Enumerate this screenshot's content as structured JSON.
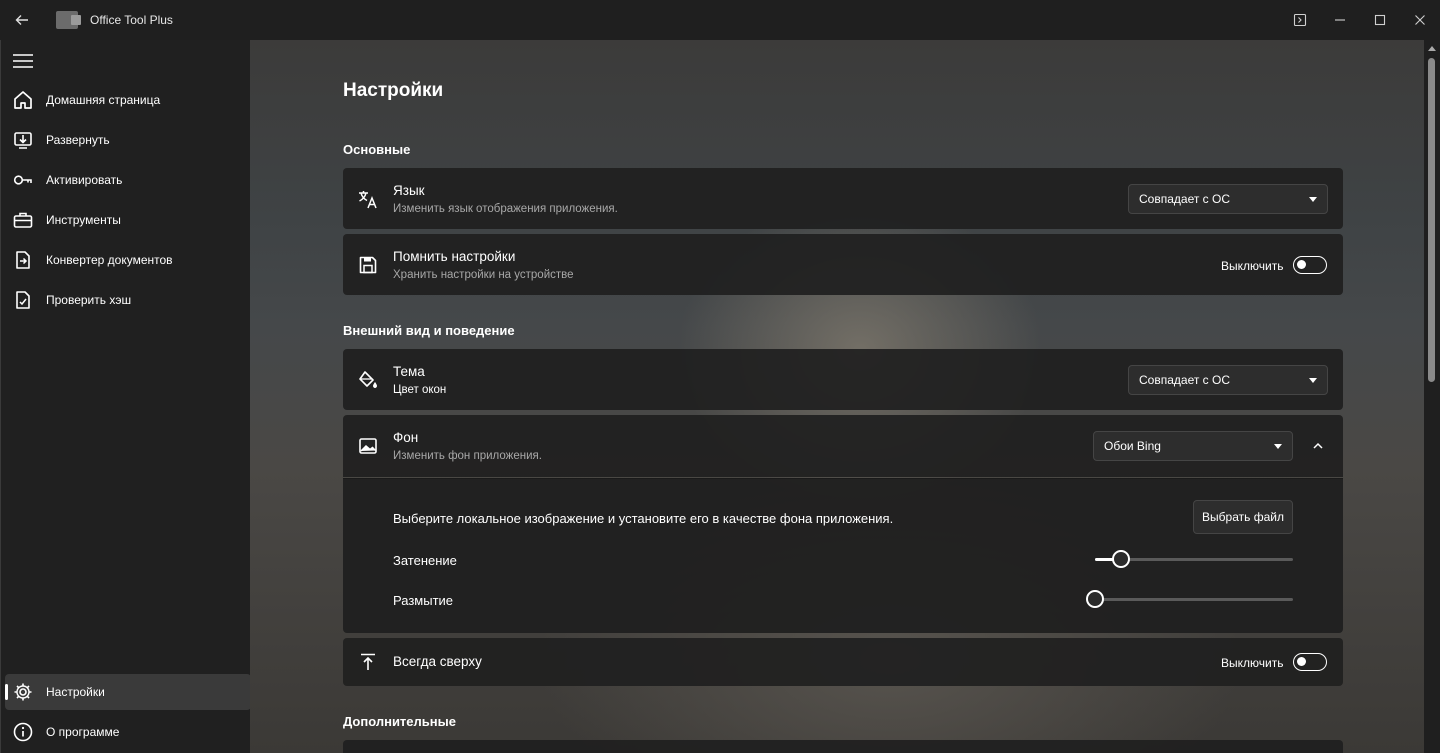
{
  "window": {
    "title": "Office Tool Plus"
  },
  "sidebar": {
    "items": [
      {
        "label": "Домашняя страница",
        "icon": "home-icon"
      },
      {
        "label": "Развернуть",
        "icon": "deploy-icon"
      },
      {
        "label": "Активировать",
        "icon": "key-icon"
      },
      {
        "label": "Инструменты",
        "icon": "toolbox-icon"
      },
      {
        "label": "Конвертер документов",
        "icon": "convert-icon"
      },
      {
        "label": "Проверить хэш",
        "icon": "hash-icon"
      }
    ],
    "footer": [
      {
        "label": "Настройки",
        "icon": "gear-icon",
        "active": true
      },
      {
        "label": "О программе",
        "icon": "info-icon"
      }
    ]
  },
  "page": {
    "title": "Настройки"
  },
  "sections": {
    "basic": "Основные",
    "appearance": "Внешний вид и поведение",
    "additional": "Дополнительные"
  },
  "settings": {
    "language": {
      "title": "Язык",
      "subtitle": "Изменить язык отображения приложения.",
      "value": "Совпадает с ОС"
    },
    "remember": {
      "title": "Помнить настройки",
      "subtitle": "Хранить настройки на устройстве",
      "toggle_label": "Выключить",
      "on": true
    },
    "theme": {
      "title": "Тема",
      "subtitle": "Цвет окон",
      "value": "Совпадает с ОС"
    },
    "background": {
      "title": "Фон",
      "subtitle": "Изменить фон приложения.",
      "value": "Обои Bing",
      "local_text": "Выберите локальное изображение и установите его в качестве фона приложения.",
      "choose_file": "Выбрать файл",
      "dimming_label": "Затенение",
      "dimming_value": 0.13,
      "blur_label": "Размытие",
      "blur_value": 0.0
    },
    "always_on_top": {
      "title": "Всегда сверху",
      "toggle_label": "Выключить",
      "on": true
    }
  }
}
